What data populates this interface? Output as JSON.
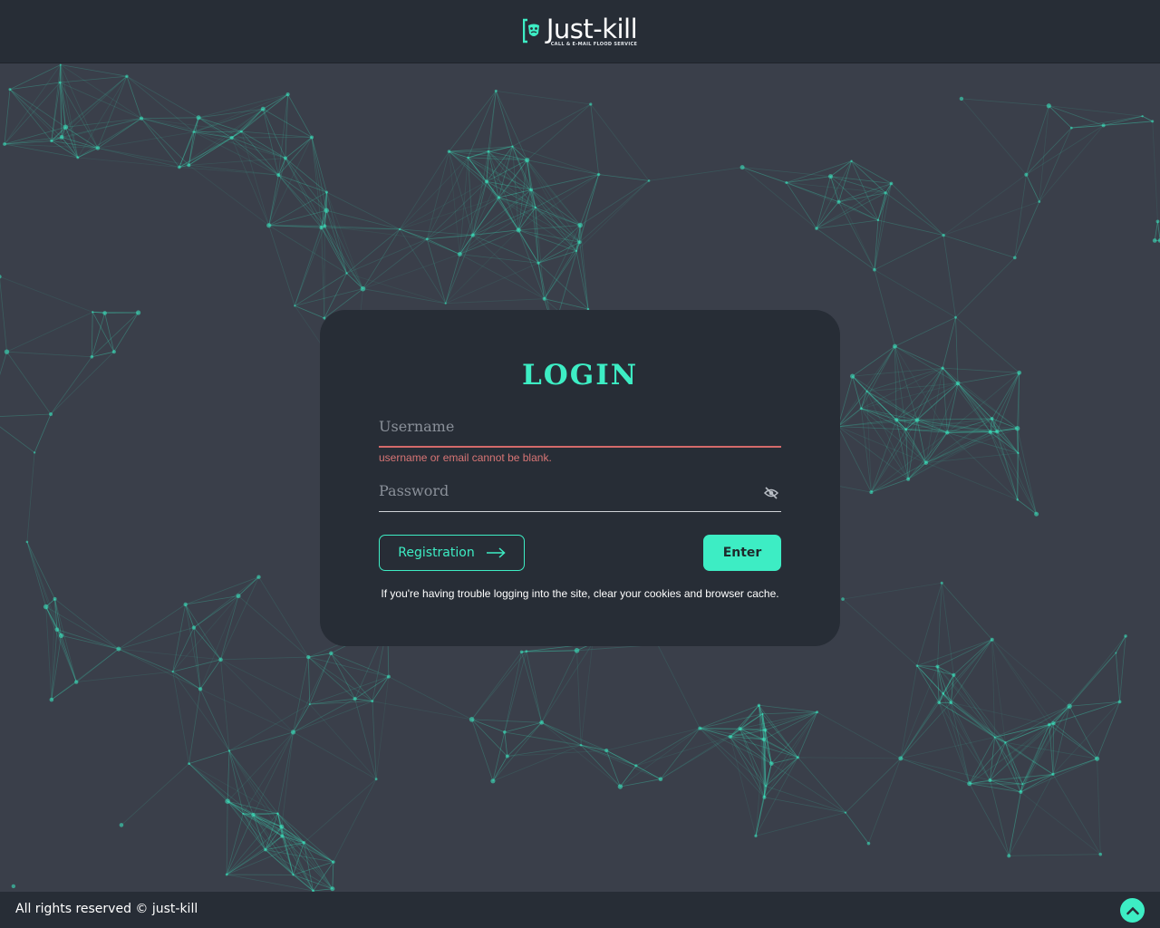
{
  "header": {
    "logo_name": "Just-kill",
    "logo_tagline": "CALL & E-MAIL FLOOD SERVICE"
  },
  "login": {
    "title": "LOGIN",
    "username_placeholder": "Username",
    "username_error": "username or email cannot be blank.",
    "password_placeholder": "Password",
    "registration_label": "Registration",
    "enter_label": "Enter",
    "hint": "If you're having trouble logging into the site, clear your cookies and browser cache."
  },
  "footer": {
    "copyright": "All rights reserved © just-kill"
  },
  "icons": {
    "logo": "mask-bracket-icon",
    "password_toggle": "eye-slash-icon",
    "registration": "arrow-right-icon",
    "scroll_top": "chevron-up-icon"
  },
  "colors": {
    "accent": "#3dedc4",
    "background": "#3a3f4a",
    "panel": "#272d36",
    "error": "#d46a6a"
  }
}
